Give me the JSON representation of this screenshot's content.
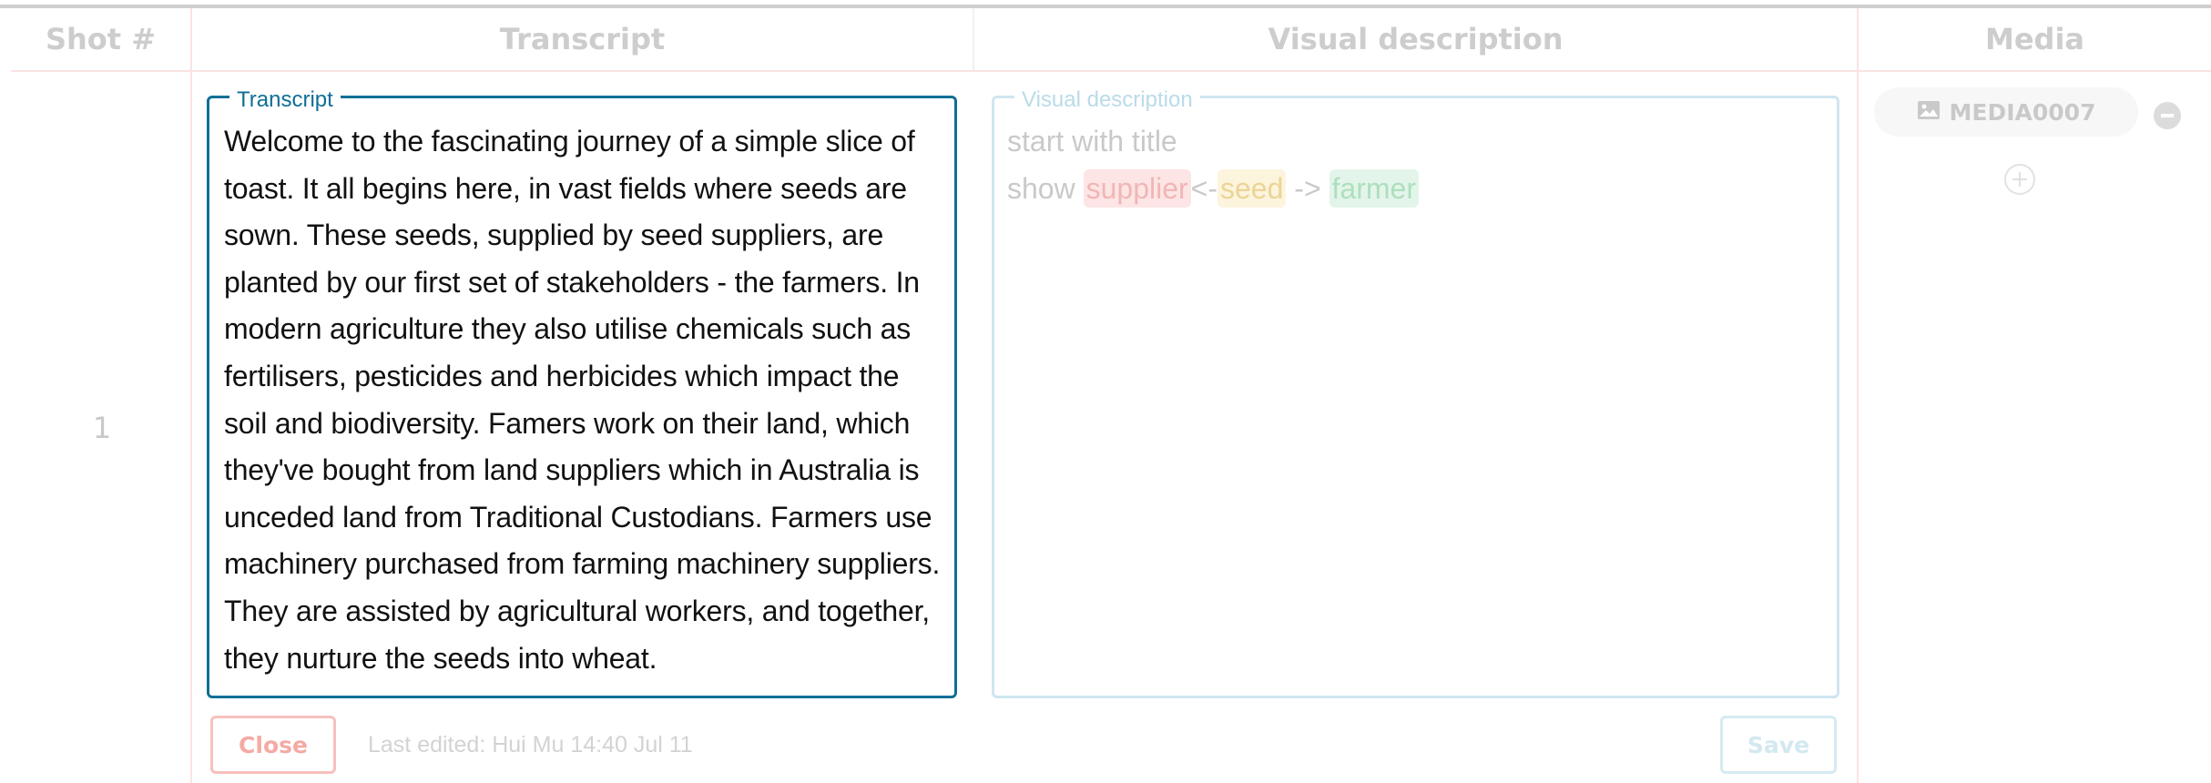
{
  "table": {
    "headers": {
      "shot": "Shot #",
      "transcript": "Transcript",
      "visual": "Visual description",
      "media": "Media"
    },
    "row": {
      "shot_number": "1",
      "transcript": {
        "legend": "Transcript",
        "value": "Welcome to the fascinating journey of a simple slice of toast. It all begins here, in vast fields where seeds are sown. These seeds, supplied by seed suppliers, are planted by our first set of stakeholders - the farmers. In modern agriculture they also utilise chemicals such as fertilisers, pesticides and herbicides which impact the soil and biodiversity. Famers work on their land, which they've bought from land suppliers which in Australia is unceded land from Traditional Custodians. Farmers use machinery purchased from farming machinery suppliers. They are assisted by agricultural workers, and together, they nurture the seeds into wheat."
      },
      "visual_description": {
        "legend": "Visual description",
        "line1": "start with title",
        "line2_prefix": "show ",
        "tag_supplier": "supplier",
        "arrow_left": "<-",
        "tag_seed": "seed",
        "arrow_right": " -> ",
        "tag_farmer": "farmer"
      },
      "media": {
        "item_label": "MEDIA0007",
        "item_icon": "image-icon",
        "remove_icon": "minus-circle-icon",
        "add_icon": "plus-circle-icon"
      }
    },
    "footer": {
      "close_label": "Close",
      "last_edited": "Last edited: Hui Mu 14:40 Jul 11",
      "save_label": "Save"
    }
  },
  "colors": {
    "accent": "#0e6f96",
    "close": "#f5aaa4",
    "grid": "#fbe3e2",
    "tag_red": "#fde5e5",
    "tag_yellow": "#fcf4dd",
    "tag_green": "#e3f5ea"
  }
}
